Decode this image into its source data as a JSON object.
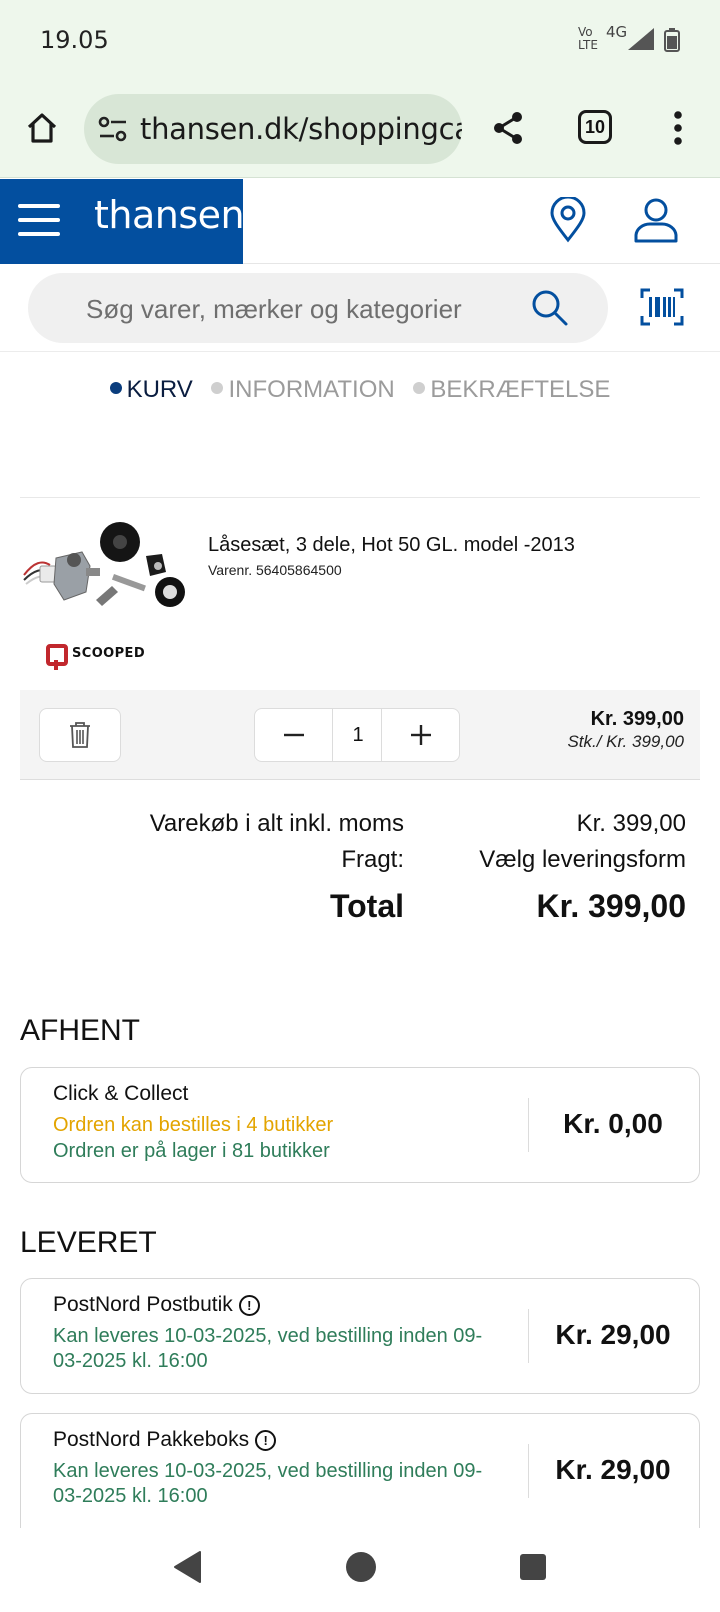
{
  "status_bar": {
    "time": "19.05",
    "network_top": "Vo",
    "network_bottom": "LTE",
    "network_gen": "4G"
  },
  "browser": {
    "url": "thansen.dk/shoppingcar",
    "tab_count": "10"
  },
  "header": {
    "logo": "thansen"
  },
  "search": {
    "placeholder": "Søg varer, mærker og kategorier"
  },
  "steps": [
    {
      "label": "KURV",
      "active": true
    },
    {
      "label": "INFORMATION",
      "active": false
    },
    {
      "label": "BEKRÆFTELSE",
      "active": false
    }
  ],
  "cart_item": {
    "title": "Låsesæt, 3 dele, Hot 50 GL. model -2013",
    "sku": "Varenr. 56405864500",
    "brand": "SCOOPED",
    "quantity": "1",
    "line_price": "Kr. 399,00",
    "unit_price": "Stk./ Kr. 399,00"
  },
  "summary": {
    "subtotal_label": "Varekøb i alt inkl. moms",
    "subtotal_value": "Kr. 399,00",
    "freight_label": "Fragt:",
    "freight_value": "Vælg leveringsform",
    "total_label": "Total",
    "total_value": "Kr. 399,00"
  },
  "pickup": {
    "heading": "AFHENT",
    "options": [
      {
        "name": "Click & Collect",
        "line1": "Ordren kan bestilles i 4 butikker",
        "line2": "Ordren er på lager i 81 butikker",
        "price": "Kr. 0,00"
      }
    ]
  },
  "delivery": {
    "heading": "LEVERET",
    "options": [
      {
        "name": "PostNord Postbutik",
        "line1": "Kan leveres 10-03-2025, ved bestilling inden 09-",
        "line2": "03-2025 kl. 16:00",
        "price": "Kr. 29,00"
      },
      {
        "name": "PostNord Pakkeboks",
        "line1": "Kan leveres 10-03-2025, ved bestilling inden 09-",
        "line2": "03-2025 kl. 16:00",
        "price": "Kr. 29,00"
      }
    ]
  },
  "colors": {
    "brand_blue": "#034f9f",
    "warning_yellow": "#e3a400",
    "stock_green": "#2f7d5a"
  },
  "icons": [
    "home-icon",
    "tune-icon",
    "share-icon",
    "more-icon",
    "menu-icon",
    "location-pin-icon",
    "user-icon",
    "search-icon",
    "barcode-icon",
    "trash-icon",
    "minus-icon",
    "plus-icon",
    "info-icon",
    "back-icon",
    "home-nav-icon",
    "recents-icon"
  ]
}
